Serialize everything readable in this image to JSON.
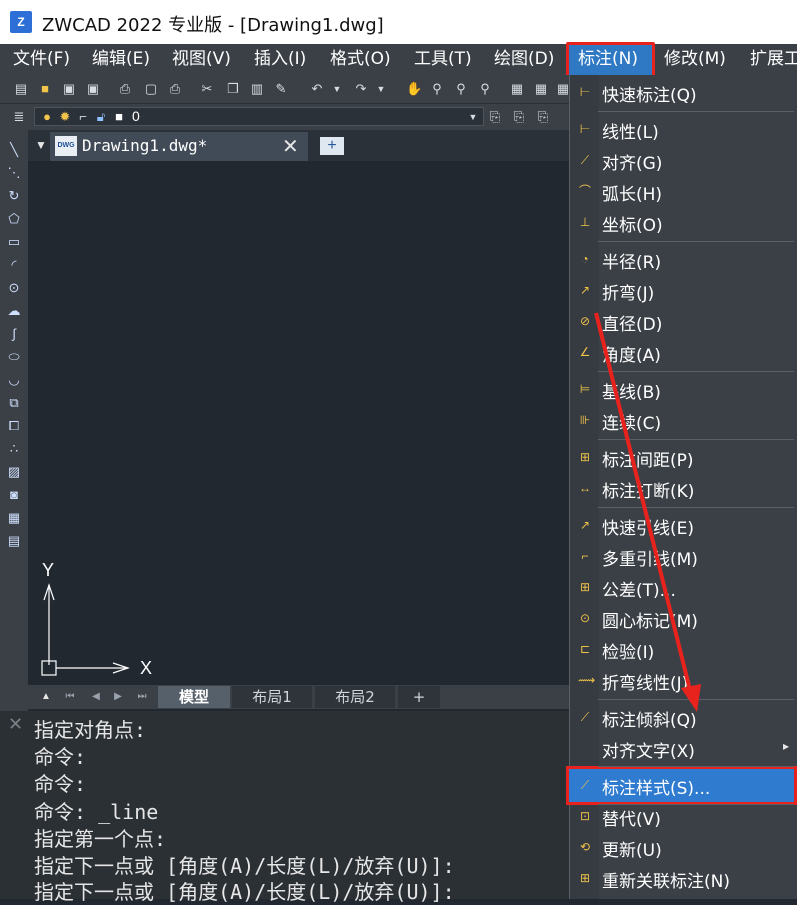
{
  "window": {
    "title": "ZWCAD 2022 专业版 - [Drawing1.dwg]",
    "logo_text": "Z"
  },
  "menubar": {
    "items": [
      "文件(F)",
      "编辑(E)",
      "视图(V)",
      "插入(I)",
      "格式(O)",
      "工具(T)",
      "绘图(D)",
      "标注(N)",
      "修改(M)",
      "扩展工"
    ]
  },
  "toolbar2": {
    "layer_value": "0"
  },
  "tabs": {
    "doc_label": "Drawing1.dwg*",
    "dwg_icon_text": "DWG"
  },
  "canvas": {
    "axis_y": "Y",
    "axis_x": "X"
  },
  "layout_tabs": [
    "模型",
    "布局1",
    "布局2",
    "+"
  ],
  "command": {
    "lines": [
      "指定对角点:",
      "命令:",
      "命令:",
      "命令: _line",
      "指定第一个点:",
      "指定下一点或 [角度(A)/长度(L)/放弃(U)]:",
      "指定下一点或 [角度(A)/长度(L)/放弃(U)]:"
    ]
  },
  "dropdown": {
    "items": [
      {
        "label": "快速标注(Q)",
        "icon": "quick-dim-icon"
      },
      {
        "label": "线性(L)",
        "icon": "linear-dim-icon"
      },
      {
        "label": "对齐(G)",
        "icon": "aligned-dim-icon"
      },
      {
        "label": "弧长(H)",
        "icon": "arc-length-icon"
      },
      {
        "label": "坐标(O)",
        "icon": "ordinate-icon"
      },
      {
        "label": "半径(R)",
        "icon": "radius-icon"
      },
      {
        "label": "折弯(J)",
        "icon": "jogged-icon"
      },
      {
        "label": "直径(D)",
        "icon": "diameter-icon"
      },
      {
        "label": "角度(A)",
        "icon": "angular-icon"
      },
      {
        "label": "基线(B)",
        "icon": "baseline-icon"
      },
      {
        "label": "连续(C)",
        "icon": "continue-icon"
      },
      {
        "label": "标注间距(P)",
        "icon": "dim-space-icon"
      },
      {
        "label": "标注打断(K)",
        "icon": "dim-break-icon"
      },
      {
        "label": "快速引线(E)",
        "icon": "qleader-icon"
      },
      {
        "label": "多重引线(M)",
        "icon": "mleader-icon"
      },
      {
        "label": "公差(T)...",
        "icon": "tolerance-icon"
      },
      {
        "label": "圆心标记(M)",
        "icon": "center-mark-icon"
      },
      {
        "label": "检验(I)",
        "icon": "inspect-icon"
      },
      {
        "label": "折弯线性(J)",
        "icon": "jogged-linear-icon"
      },
      {
        "label": "标注倾斜(Q)",
        "icon": "oblique-icon"
      },
      {
        "label": "对齐文字(X)",
        "icon": ""
      },
      {
        "label": "标注样式(S)...",
        "icon": "dim-style-icon"
      },
      {
        "label": "替代(V)",
        "icon": "override-icon"
      },
      {
        "label": "更新(U)",
        "icon": "update-icon"
      },
      {
        "label": "重新关联标注(N)",
        "icon": "reassociate-icon"
      }
    ],
    "submenu_arrow": "▸"
  },
  "colors": {
    "highlight_red": "#e8231e",
    "selection_blue": "#2f7bd0",
    "menubar": "#3b4047",
    "canvas": "#212830"
  }
}
